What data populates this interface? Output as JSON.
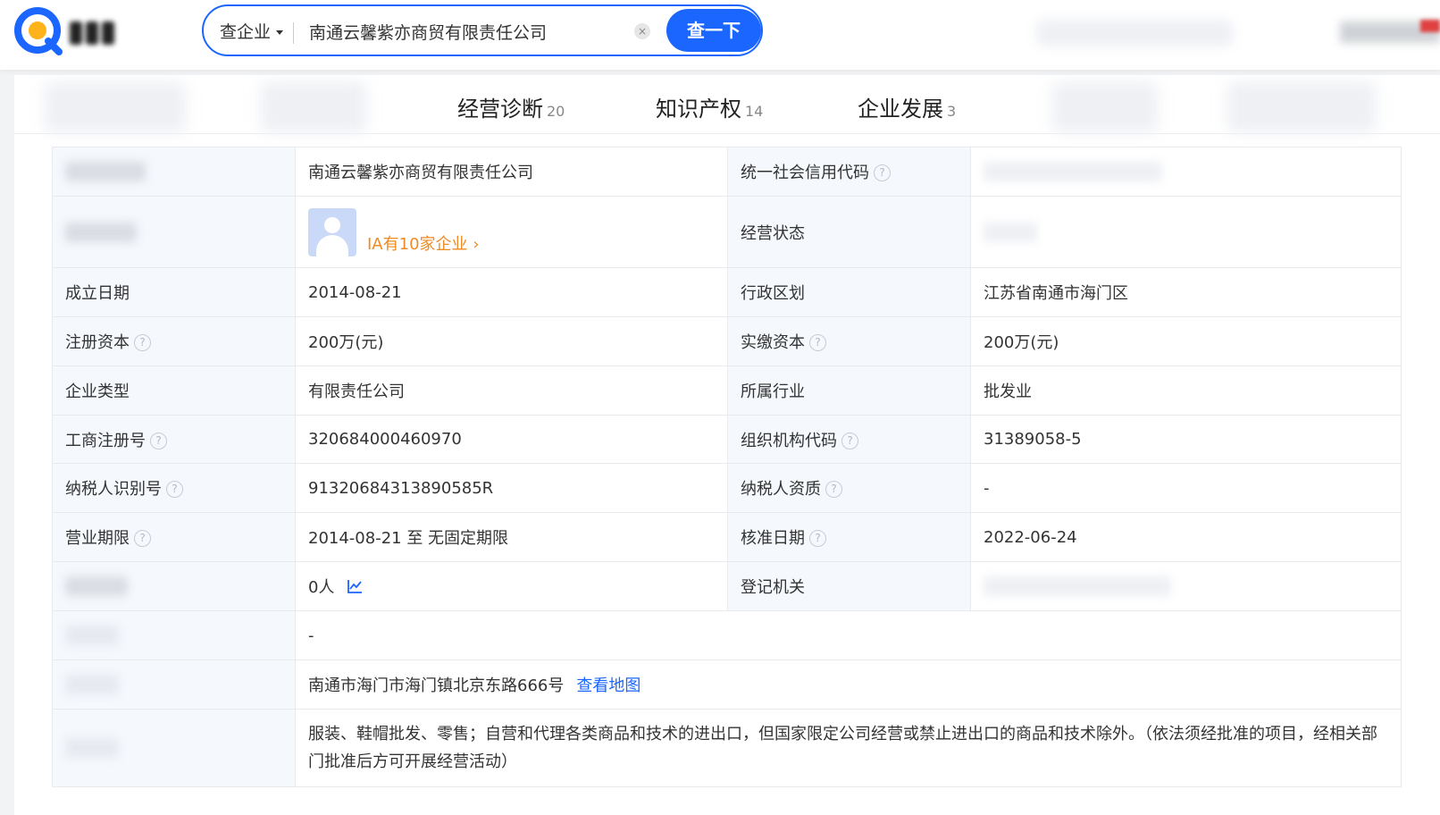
{
  "search": {
    "type_label": "查企业",
    "query": "南通云馨紫亦商贸有限责任公司",
    "clear_icon": "×",
    "button_label": "查一下"
  },
  "tabs": [
    {
      "label": "经营诊断",
      "count": "20"
    },
    {
      "label": "知识产权",
      "count": "14"
    },
    {
      "label": "企业发展",
      "count": "3"
    }
  ],
  "info": {
    "company_name": "南通云馨紫亦商贸有限责任公司",
    "credit_code_label": "统一社会信用代码",
    "rep_companies": "IA有10家企业",
    "status_label": "经营状态",
    "found_date_label": "成立日期",
    "found_date": "2014-08-21",
    "region_label": "行政区划",
    "region": "江苏省南通市海门区",
    "reg_capital_label": "注册资本",
    "reg_capital": "200万(元)",
    "paid_capital_label": "实缴资本",
    "paid_capital": "200万(元)",
    "type_label": "企业类型",
    "type": "有限责任公司",
    "industry_label": "所属行业",
    "industry": "批发业",
    "biz_reg_no_label": "工商注册号",
    "biz_reg_no": "320684000460970",
    "org_code_label": "组织机构代码",
    "org_code": "31389058-5",
    "taxpayer_id_label": "纳税人识别号",
    "taxpayer_id": "91320684313890585R",
    "taxpayer_qual_label": "纳税人资质",
    "taxpayer_qual": "-",
    "biz_term_label": "营业期限",
    "biz_term": "2014-08-21 至 无固定期限",
    "approval_date_label": "核准日期",
    "approval_date": "2022-06-24",
    "staff": "0人",
    "reg_authority_label": "登记机关",
    "former_name": "-",
    "address": "南通市海门市海门镇北京东路666号",
    "map_link": "查看地图",
    "scope": "服装、鞋帽批发、零售；自营和代理各类商品和技术的进出口，但国家限定公司经营或禁止进出口的商品和技术除外。（依法须经批准的项目，经相关部门批准后方可开展经营活动）"
  },
  "colors": {
    "brand_blue": "#1a66ff",
    "orange_link": "#f08a24",
    "label_bg": "#f5f8fc"
  },
  "icons": {
    "help": "?",
    "chevron": "›"
  }
}
